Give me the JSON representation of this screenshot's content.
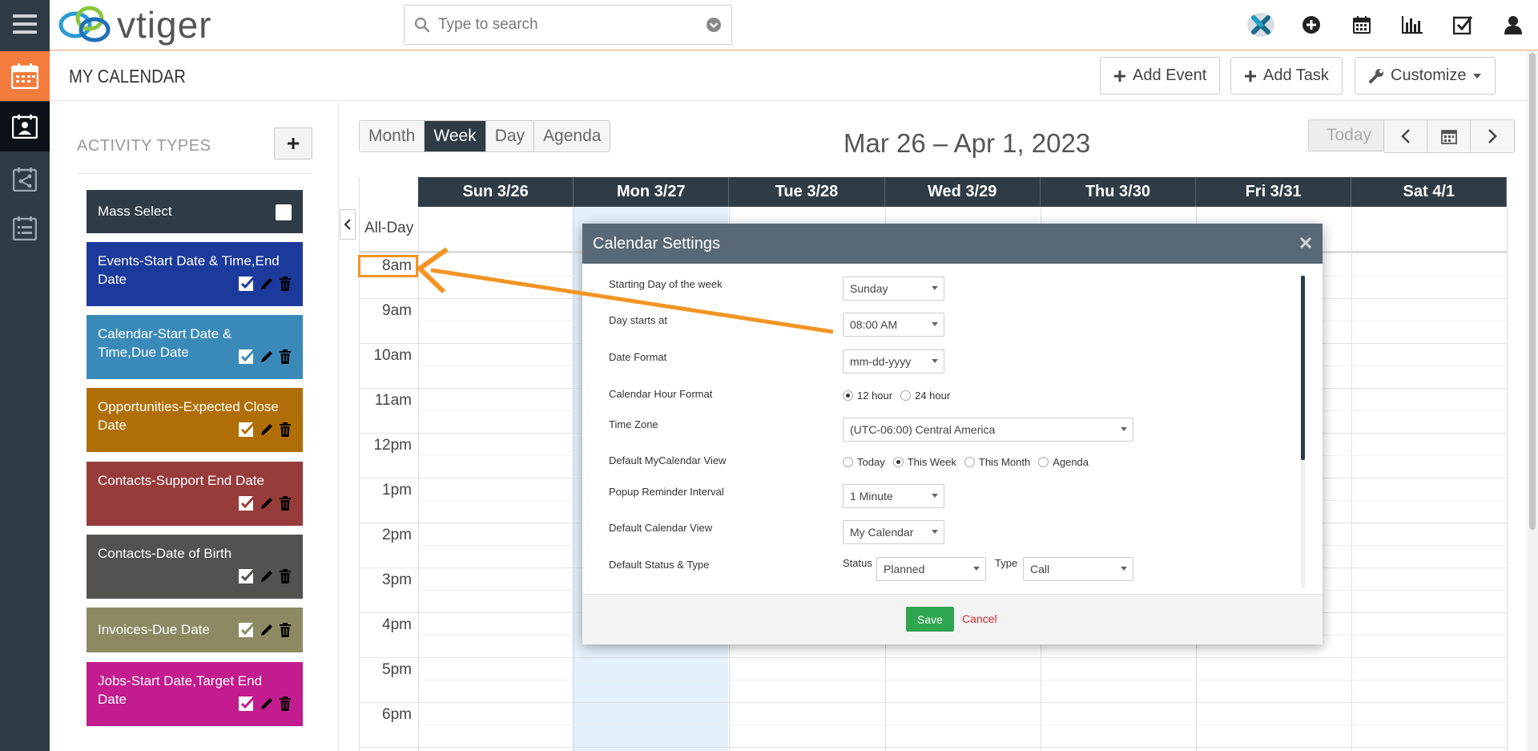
{
  "app": {
    "logo_text": "vtiger",
    "search_placeholder": "Type to search"
  },
  "page": {
    "title": "MY CALENDAR",
    "buttons": {
      "add_event": "Add Event",
      "add_task": "Add Task",
      "customize": "Customize"
    }
  },
  "activity_types": {
    "title": "ACTIVITY TYPES",
    "mass_select": "Mass Select",
    "items": [
      {
        "label": "Events-Start Date & Time,End Date",
        "color": "#1b3a9c"
      },
      {
        "label": "Calendar-Start Date & Time,Due Date",
        "color": "#3a8ab9"
      },
      {
        "label": "Opportunities-Expected Close Date",
        "color": "#b06f06"
      },
      {
        "label": "Contacts-Support End Date",
        "color": "#983b3b"
      },
      {
        "label": "Contacts-Date of Birth",
        "color": "#54524f"
      },
      {
        "label": "Invoices-Due Date",
        "color": "#8c8a63"
      },
      {
        "label": "Jobs-Start Date,Target End Date",
        "color": "#c21c8e"
      }
    ]
  },
  "calendar": {
    "view_tabs": [
      "Month",
      "Week",
      "Day",
      "Agenda"
    ],
    "active_view": "Week",
    "range_title": "Mar 26 – Apr 1, 2023",
    "today_label": "Today",
    "days": [
      "Sun 3/26",
      "Mon 3/27",
      "Tue 3/28",
      "Wed 3/29",
      "Thu 3/30",
      "Fri 3/31",
      "Sat 4/1"
    ],
    "all_day_label": "All-Day",
    "hours": [
      "8am",
      "9am",
      "10am",
      "11am",
      "12pm",
      "1pm",
      "2pm",
      "3pm",
      "4pm",
      "5pm",
      "6pm"
    ]
  },
  "settings_modal": {
    "title": "Calendar Settings",
    "labels": {
      "starting_day": "Starting Day of the week",
      "day_starts": "Day starts at",
      "date_format": "Date Format",
      "hour_format": "Calendar Hour Format",
      "time_zone": "Time Zone",
      "default_mycal_view": "Default MyCalendar View",
      "reminder": "Popup Reminder Interval",
      "default_cal_view": "Default Calendar View",
      "default_status_type": "Default Status & Type"
    },
    "values": {
      "starting_day": "Sunday",
      "day_starts": "08:00 AM",
      "date_format": "mm-dd-yyyy",
      "time_zone": "(UTC-06:00) Central America",
      "reminder": "1 Minute",
      "default_cal_view": "My Calendar",
      "status": "Planned",
      "type": "Call"
    },
    "hour_options": [
      "12 hour",
      "24 hour"
    ],
    "hour_selected": "12 hour",
    "view_options": [
      "Today",
      "This Week",
      "This Month",
      "Agenda"
    ],
    "view_selected": "This Week",
    "status_label": "Status",
    "type_label": "Type",
    "save_label": "Save",
    "cancel_label": "Cancel"
  },
  "annotation": {
    "highlight_color": "#f39423"
  }
}
